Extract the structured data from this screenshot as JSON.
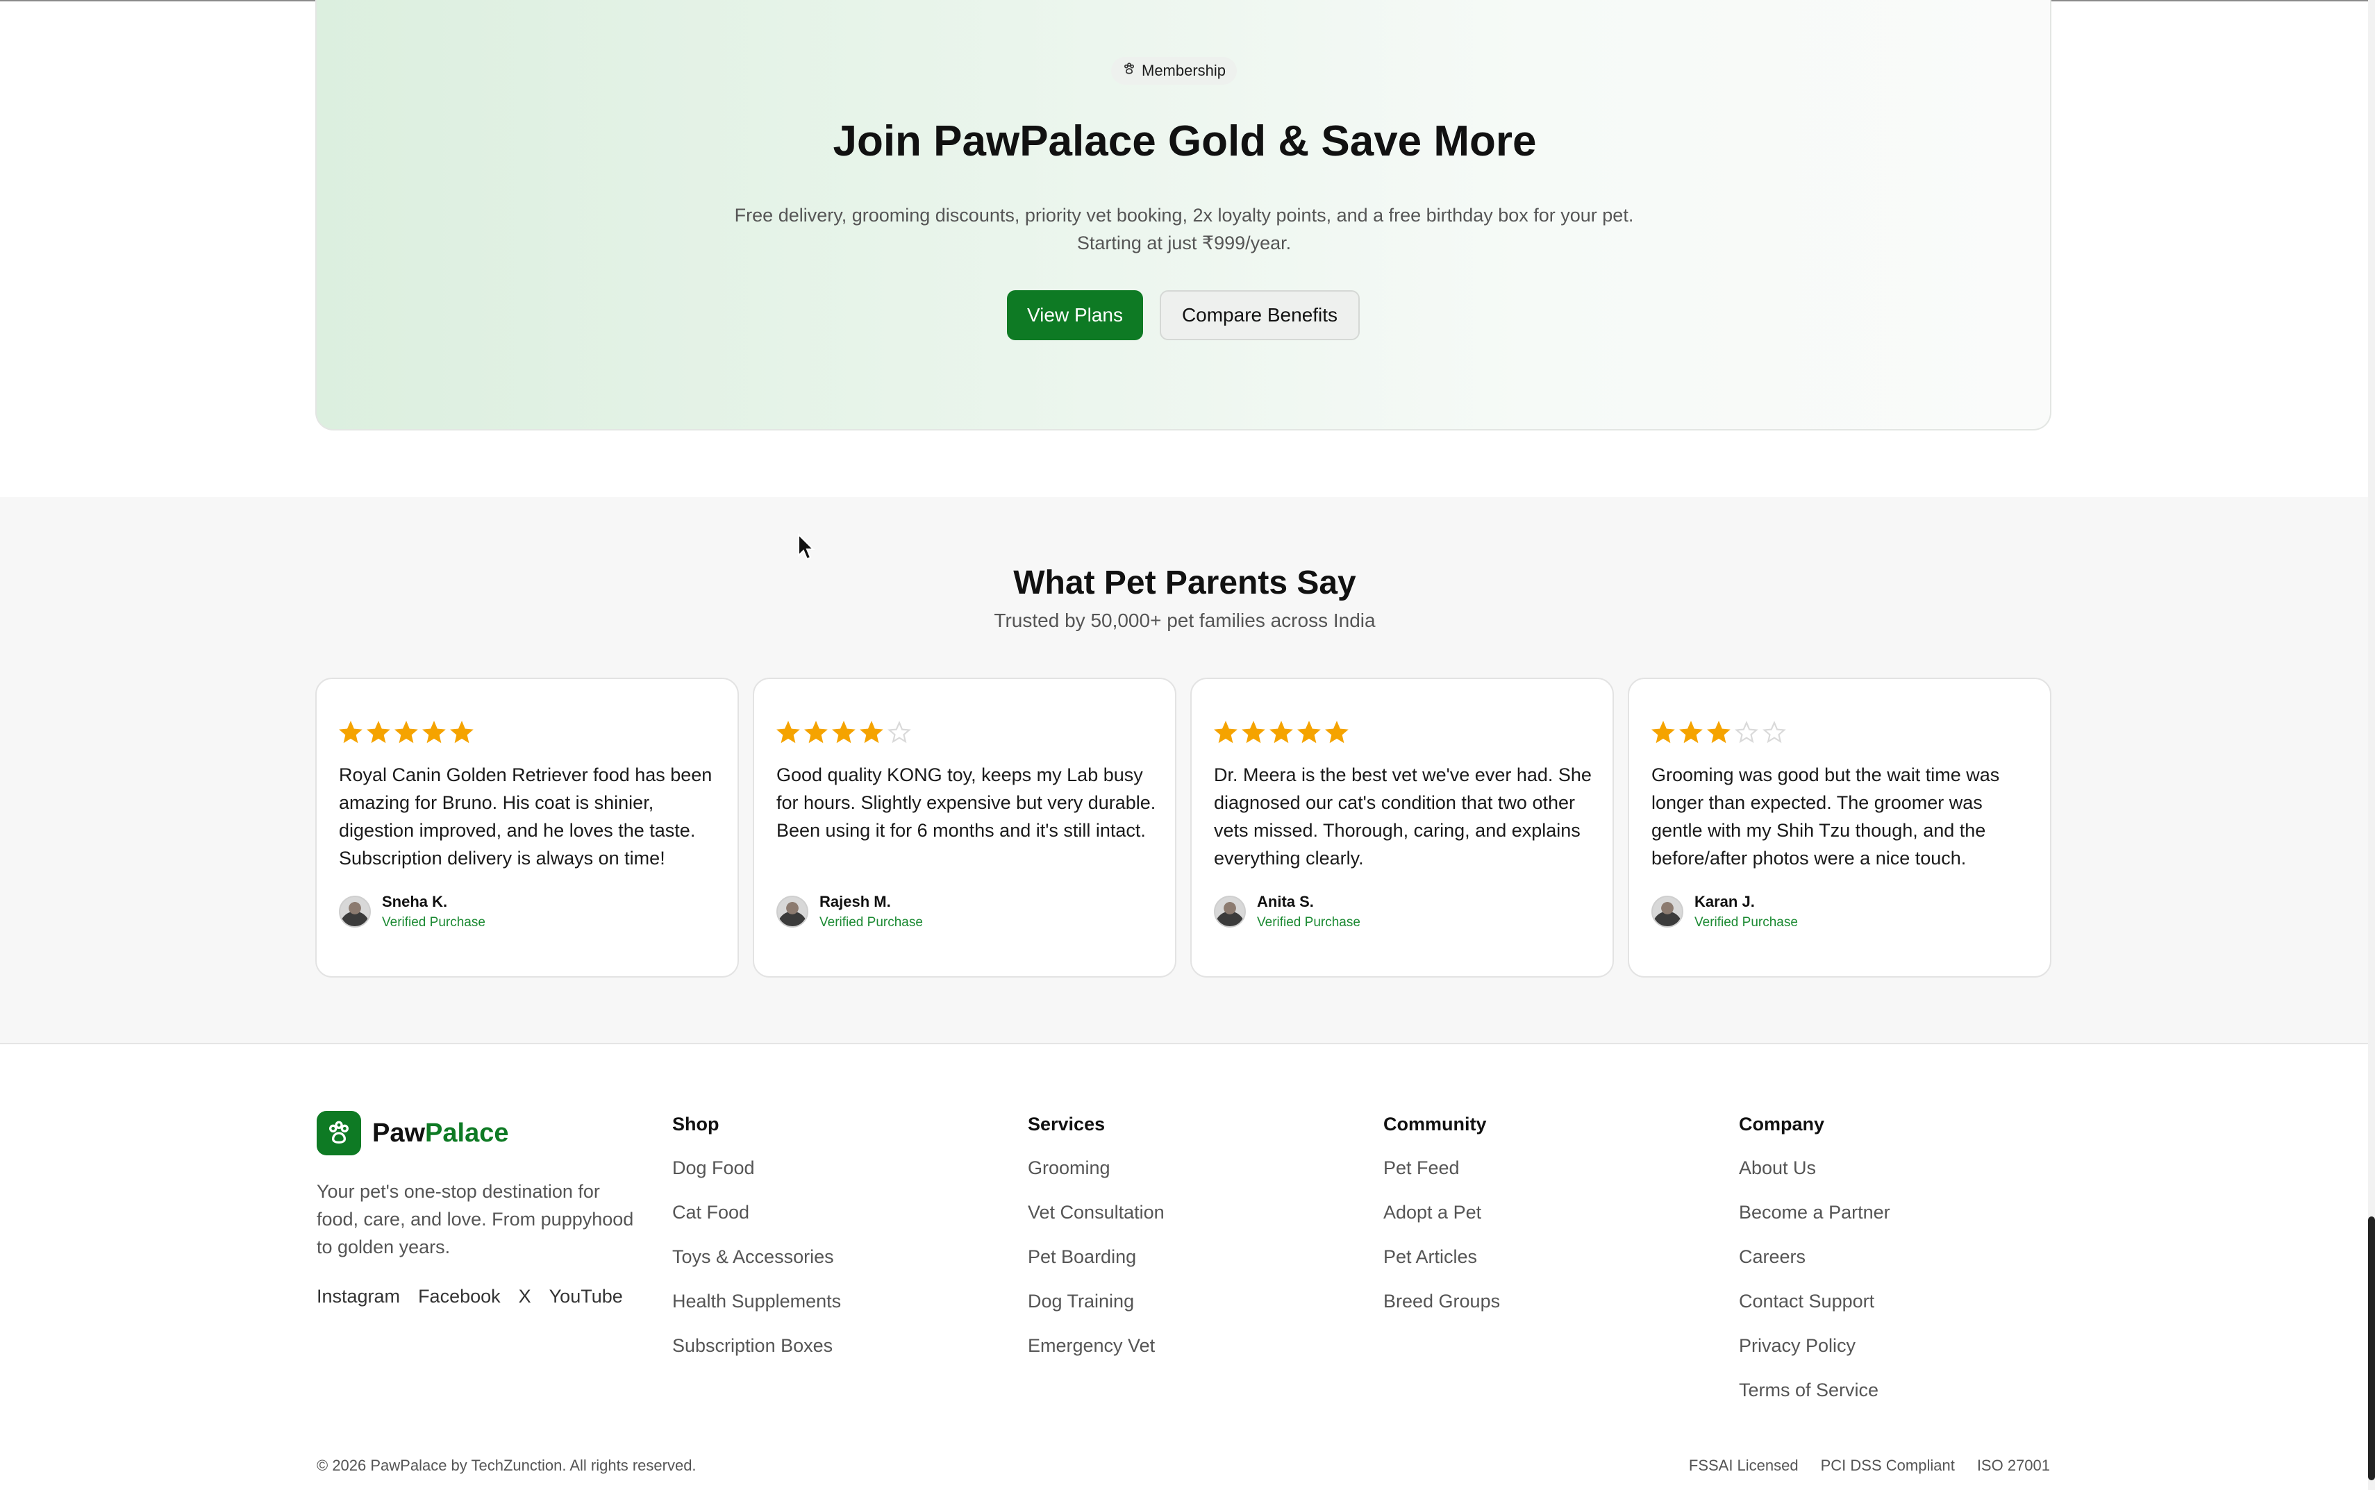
{
  "membership": {
    "badge": "Membership",
    "title": "Join PawPalace Gold & Save More",
    "description": "Free delivery, grooming discounts, priority vet booking, 2x loyalty points, and a free birthday box for your pet. Starting at just ₹999/year.",
    "primary_button": "View Plans",
    "secondary_button": "Compare Benefits"
  },
  "reviews": {
    "title": "What Pet Parents Say",
    "subtitle": "Trusted by 50,000+ pet families across India",
    "items": [
      {
        "rating": 5,
        "text": "Royal Canin Golden Retriever food has been amazing for Bruno. His coat is shinier, digestion improved, and he loves the taste. Subscription delivery is always on time!",
        "author": "Sneha K.",
        "badge": "Verified Purchase"
      },
      {
        "rating": 4,
        "text": "Good quality KONG toy, keeps my Lab busy for hours. Slightly expensive but very durable. Been using it for 6 months and it's still intact.",
        "author": "Rajesh M.",
        "badge": "Verified Purchase"
      },
      {
        "rating": 5,
        "text": "Dr. Meera is the best vet we've ever had. She diagnosed our cat's condition that two other vets missed. Thorough, caring, and explains everything clearly.",
        "author": "Anita S.",
        "badge": "Verified Purchase"
      },
      {
        "rating": 3,
        "text": "Grooming was good but the wait time was longer than expected. The groomer was gentle with my Shih Tzu though, and the before/after photos were a nice touch.",
        "author": "Karan J.",
        "badge": "Verified Purchase"
      }
    ]
  },
  "footer": {
    "brand_first": "Paw",
    "brand_second": "Palace",
    "description": "Your pet's one-stop destination for food, care, and love. From puppyhood to golden years.",
    "socials": [
      "Instagram",
      "Facebook",
      "X",
      "YouTube"
    ],
    "columns": [
      {
        "title": "Shop",
        "links": [
          "Dog Food",
          "Cat Food",
          "Toys & Accessories",
          "Health Supplements",
          "Subscription Boxes"
        ]
      },
      {
        "title": "Services",
        "links": [
          "Grooming",
          "Vet Consultation",
          "Pet Boarding",
          "Dog Training",
          "Emergency Vet"
        ]
      },
      {
        "title": "Community",
        "links": [
          "Pet Feed",
          "Adopt a Pet",
          "Pet Articles",
          "Breed Groups"
        ]
      },
      {
        "title": "Company",
        "links": [
          "About Us",
          "Become a Partner",
          "Careers",
          "Contact Support",
          "Privacy Policy",
          "Terms of Service"
        ]
      }
    ],
    "copyright": "© 2026 PawPalace by TechZunction. All rights reserved.",
    "compliance": [
      "FSSAI Licensed",
      "PCI DSS Compliant",
      "ISO 27001"
    ]
  },
  "colors": {
    "brand_green": "#0e7a24",
    "star_filled": "#f5a300",
    "star_empty": "#d9d9d9",
    "verified_green": "#1c8a33"
  }
}
